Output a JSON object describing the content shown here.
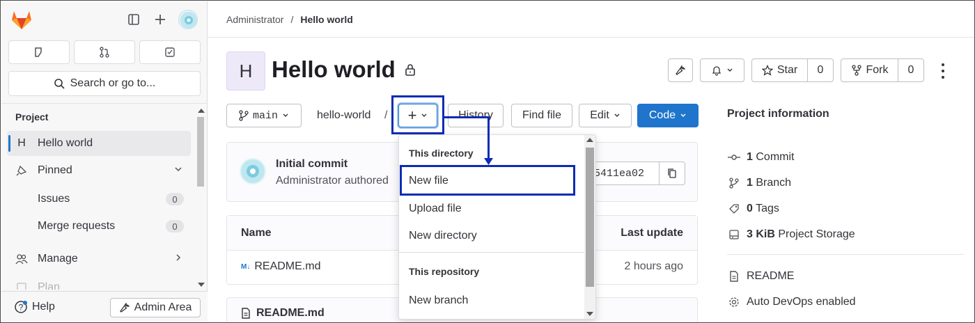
{
  "breadcrumb": {
    "parent": "Administrator",
    "separator": "/",
    "current": "Hello world"
  },
  "sidebar": {
    "search_label": "Search or go to...",
    "section_label": "Project",
    "project_initial": "H",
    "items": [
      {
        "label": "Hello world"
      },
      {
        "label": "Pinned"
      },
      {
        "label": "Issues",
        "count": "0"
      },
      {
        "label": "Merge requests",
        "count": "0"
      },
      {
        "label": "Manage"
      },
      {
        "label": "Plan"
      }
    ],
    "help_label": "Help",
    "admin_label": "Admin Area"
  },
  "project": {
    "initial": "H",
    "title": "Hello world",
    "star_label": "Star",
    "star_count": "0",
    "fork_label": "Fork",
    "fork_count": "0"
  },
  "toolbar": {
    "branch": "main",
    "path": "hello-world",
    "path_sep": "/",
    "add_symbol": "+",
    "history_label": "History",
    "find_file_label": "Find file",
    "edit_label": "Edit",
    "code_label": "Code"
  },
  "commit": {
    "title": "Initial commit",
    "author": "Administrator authored",
    "sha": "5411ea02"
  },
  "files": {
    "headers": {
      "name": "Name",
      "last_update": "Last update"
    },
    "rows": [
      {
        "name": "README.md",
        "updated": "2 hours ago"
      }
    ]
  },
  "readme": {
    "title": "README.md"
  },
  "dropdown": {
    "section1": "This directory",
    "items1": [
      "New file",
      "Upload file",
      "New directory"
    ],
    "section2": "This repository",
    "items2": [
      "New branch"
    ]
  },
  "info": {
    "title": "Project information",
    "commits": {
      "count": "1",
      "label": "Commit"
    },
    "branches": {
      "count": "1",
      "label": "Branch"
    },
    "tags": {
      "count": "0",
      "label": "Tags"
    },
    "storage": {
      "count": "3 KiB",
      "label": "Project Storage"
    },
    "readme_label": "README",
    "devops_label": "Auto DevOps enabled"
  },
  "colors": {
    "primary": "#1f75cb",
    "highlight": "#0d2bb4",
    "gitlab_orange": "#e24329"
  }
}
